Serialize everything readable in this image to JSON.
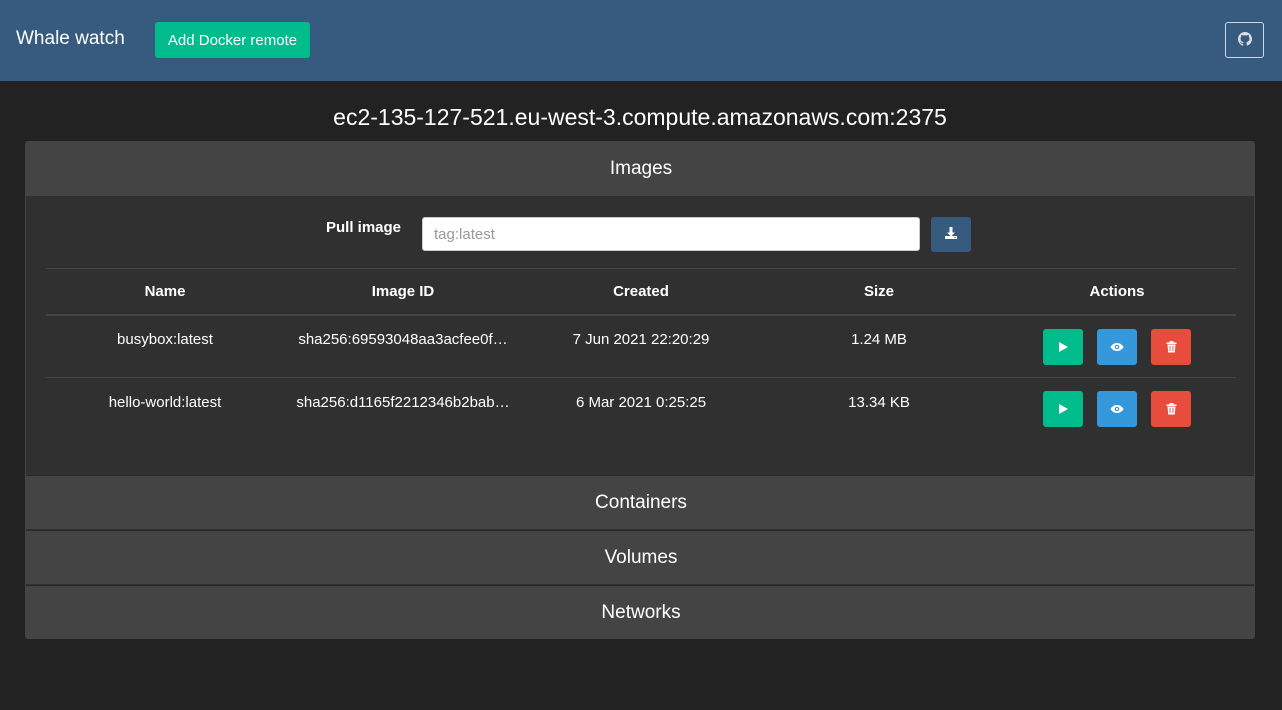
{
  "navbar": {
    "brand": "Whale watch",
    "add_remote_label": "Add Docker remote",
    "github_icon": "github-icon"
  },
  "host": {
    "title": "ec2-135-127-521.eu-west-3.compute.amazonaws.com:2375"
  },
  "sections": {
    "images": "Images",
    "containers": "Containers",
    "volumes": "Volumes",
    "networks": "Networks"
  },
  "pull": {
    "label": "Pull image",
    "placeholder": "tag:latest",
    "button_icon": "download-icon"
  },
  "table": {
    "headers": {
      "name": "Name",
      "image_id": "Image ID",
      "created": "Created",
      "size": "Size",
      "actions": "Actions"
    },
    "rows": [
      {
        "name": "busybox:latest",
        "image_id": "sha256:69593048aa3acfee0f…",
        "created": "7 Jun 2021 22:20:29",
        "size": "1.24 MB"
      },
      {
        "name": "hello-world:latest",
        "image_id": "sha256:d1165f2212346b2bab…",
        "created": "6 Mar 2021 0:25:25",
        "size": "13.34 KB"
      }
    ],
    "action_icons": [
      "play-icon",
      "eye-icon",
      "trash-icon"
    ]
  },
  "colors": {
    "navbar": "#375a7f",
    "success": "#00bc8c",
    "info": "#3498db",
    "danger": "#e74c3c",
    "background": "#222222",
    "panel": "#303030",
    "section_header": "#444444"
  }
}
